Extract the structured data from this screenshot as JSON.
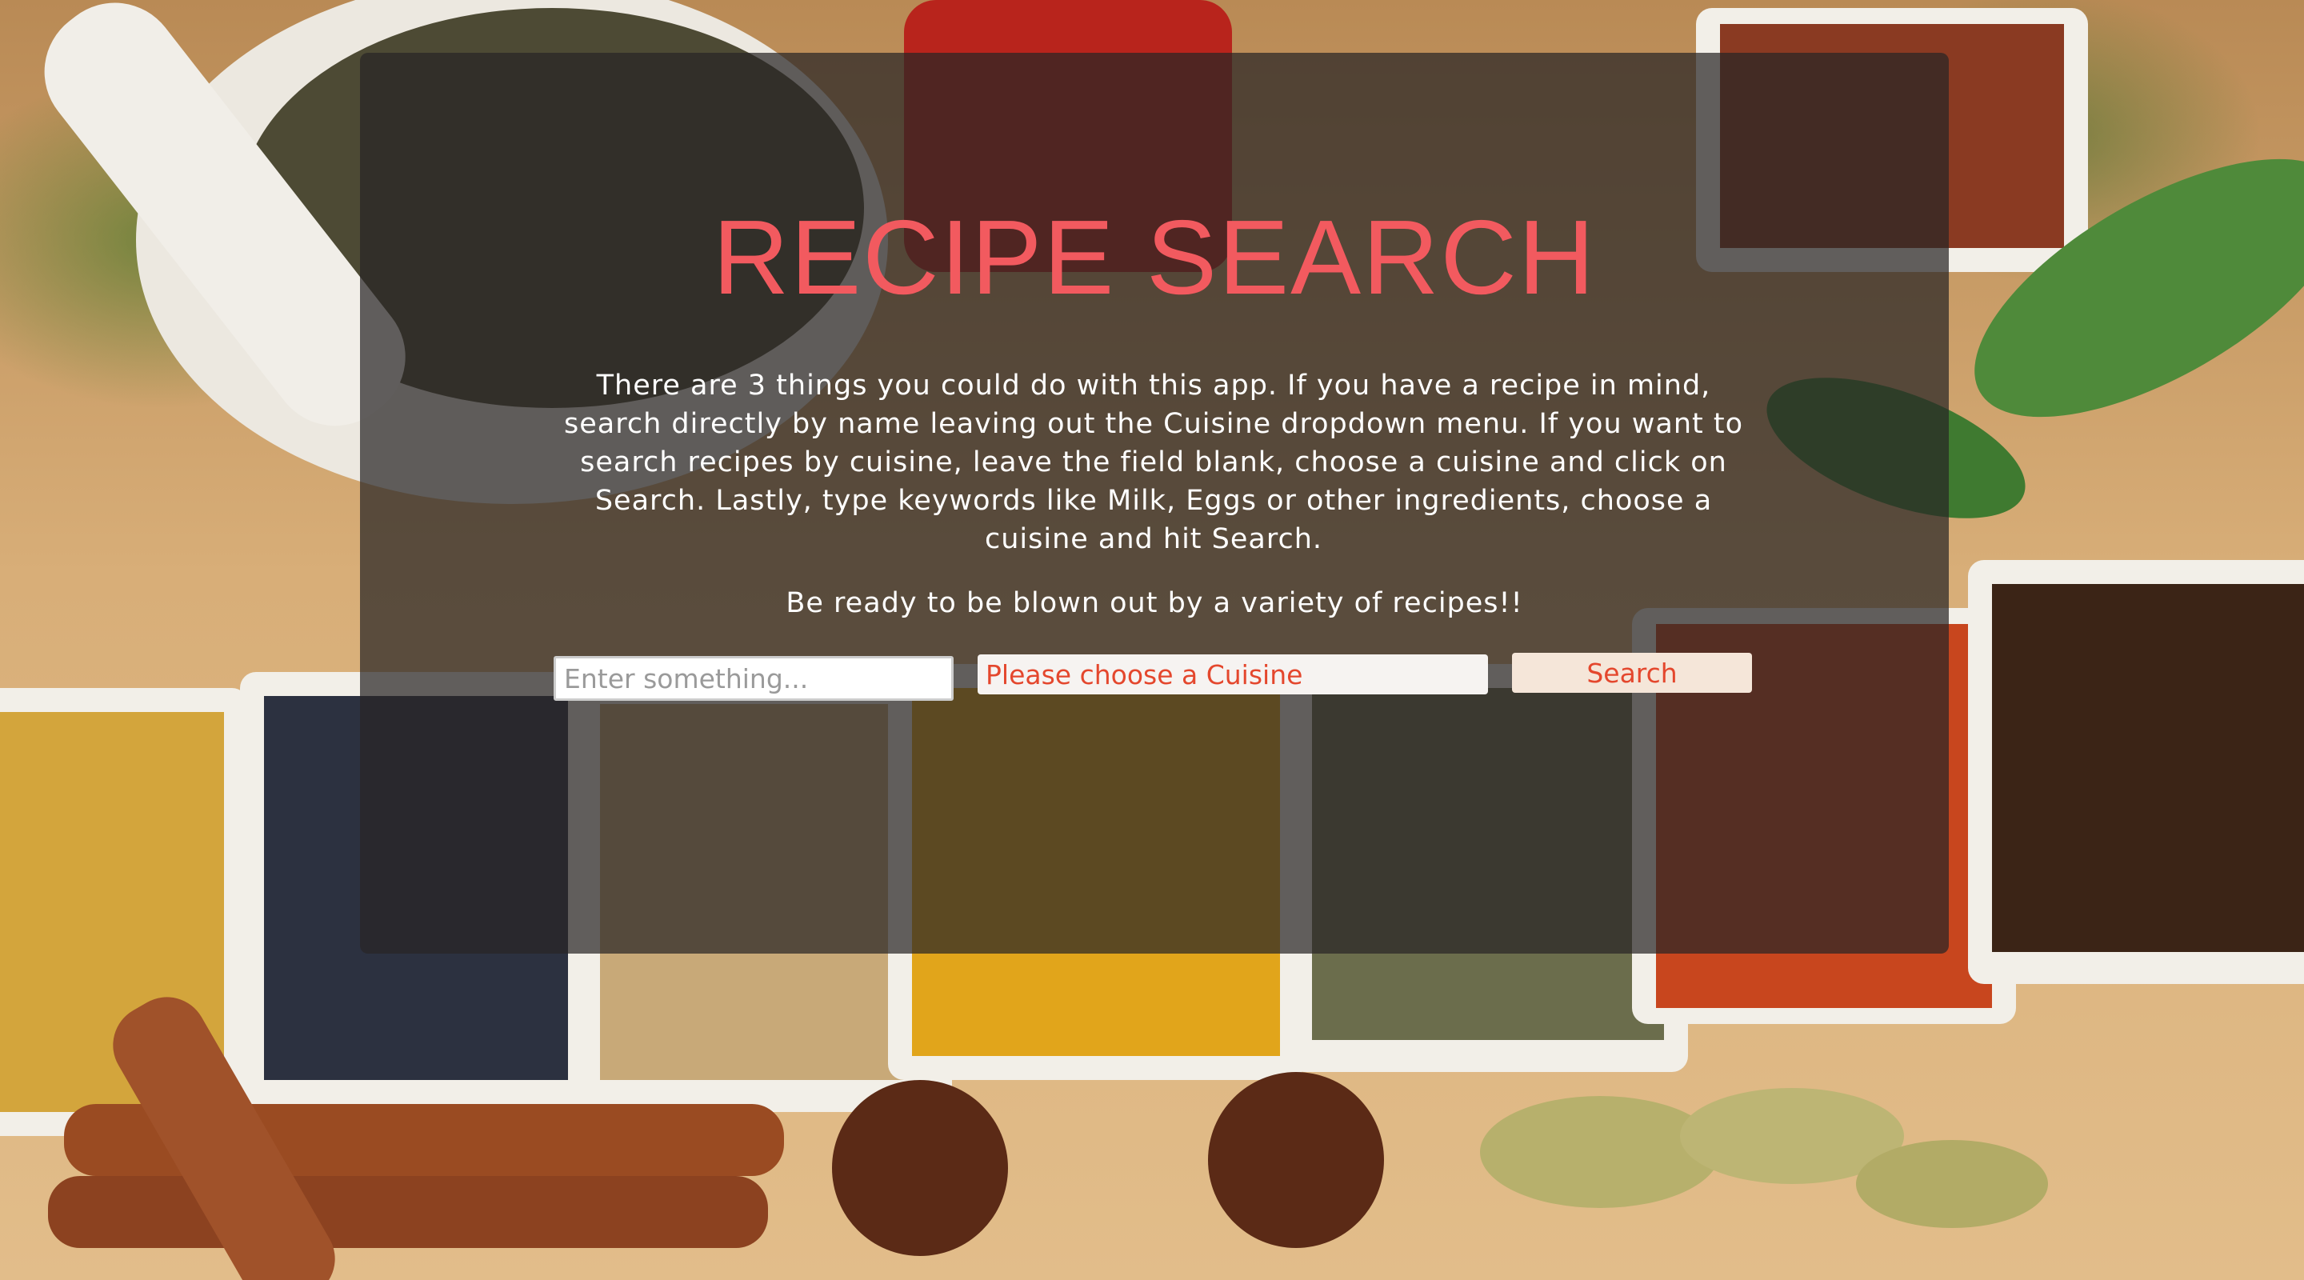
{
  "header": {
    "title": "RECIPE SEARCH"
  },
  "intro": {
    "description": "There are 3 things you could do with this app. If you have a recipe in mind, search directly by name leaving out the Cuisine dropdown menu. If you want to search recipes by cuisine, leave the field blank, choose a cuisine and click on Search. Lastly, type keywords like Milk, Eggs or other ingredients, choose a cuisine and hit Search.",
    "tagline": "Be ready to be blown out by a variety of recipes!!"
  },
  "search": {
    "input_value": "",
    "input_placeholder": "Enter something...",
    "cuisine_selected": "Please choose a Cuisine",
    "button_label": "Search"
  },
  "colors": {
    "title": "#f25a5f",
    "accent_text": "#e4472d",
    "panel_overlay": "rgba(40,38,38,0.72)",
    "button_bg": "#f5e6d9"
  }
}
